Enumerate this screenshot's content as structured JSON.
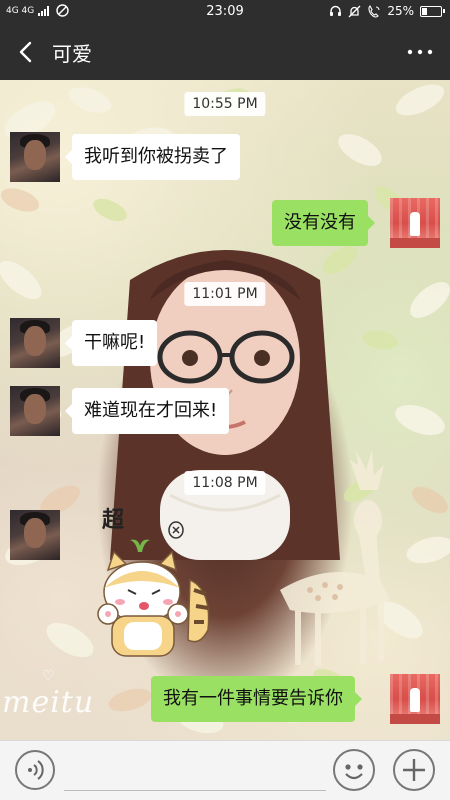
{
  "status_bar": {
    "network": "4G 4G",
    "time": "23:09",
    "battery_text": "25%",
    "battery_level": 0.25,
    "icons": [
      "signal-icon",
      "no-disturb-icon",
      "headset-icon",
      "bell-off-icon",
      "wifi-call-icon",
      "battery-icon"
    ]
  },
  "header": {
    "title": "可爱",
    "back_icon": "chevron-left-icon",
    "more_icon": "more-dots-icon"
  },
  "messages": [
    {
      "type": "timestamp",
      "text": "10:55 PM"
    },
    {
      "type": "text",
      "from": "friend",
      "text": "我听到你被拐卖了"
    },
    {
      "type": "text",
      "from": "me",
      "text": "没有没有"
    },
    {
      "type": "timestamp",
      "text": "11:01 PM"
    },
    {
      "type": "text",
      "from": "friend",
      "text": "干嘛呢!"
    },
    {
      "type": "text",
      "from": "friend",
      "text": "难道现在才回来!"
    },
    {
      "type": "timestamp",
      "text": "11:08 PM"
    },
    {
      "type": "sticker",
      "from": "friend",
      "text": "超"
    },
    {
      "type": "text",
      "from": "me",
      "text": "我有一件事情要告诉你"
    }
  ],
  "background": {
    "watermark": "meitu"
  },
  "input_bar": {
    "placeholder": "",
    "voice_icon": "voice-icon",
    "emoji_icon": "emoji-icon",
    "plus_icon": "plus-icon"
  },
  "colors": {
    "header_bg": "#2e2e2e",
    "my_bubble": "#9ae063",
    "friend_bubble": "#ffffff",
    "input_bar_bg": "#f4f4f4"
  }
}
